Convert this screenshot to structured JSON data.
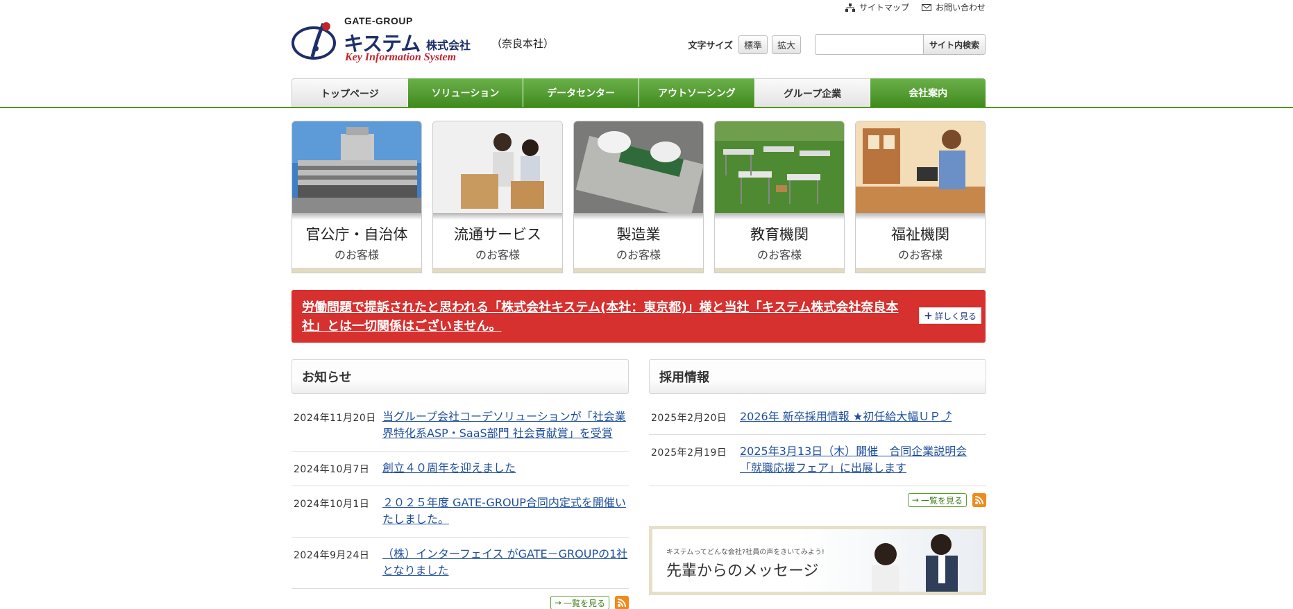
{
  "header": {
    "logo": {
      "group": "GATE-GROUP",
      "name": "キステム",
      "suffix": "株式会社",
      "branch": "（奈良本社）",
      "tagline": "Key Information System"
    },
    "util_links": [
      {
        "label": "サイトマップ",
        "icon": "sitemap-icon"
      },
      {
        "label": "お問い合わせ",
        "icon": "mail-icon"
      }
    ],
    "font_size": {
      "label": "文字サイズ",
      "normal": "標準",
      "large": "拡大"
    },
    "search": {
      "value": "",
      "placeholder": "",
      "button": "サイト内検索"
    }
  },
  "nav": [
    {
      "label": "トップページ",
      "style": "light"
    },
    {
      "label": "ソリューション",
      "style": "green"
    },
    {
      "label": "データセンター",
      "style": "green"
    },
    {
      "label": "アウトソーシング",
      "style": "green"
    },
    {
      "label": "グループ企業",
      "style": "light"
    },
    {
      "label": "会社案内",
      "style": "green"
    }
  ],
  "categories": [
    {
      "title": "官公庁・自治体",
      "sub": "のお客様",
      "image": "government-building-photo"
    },
    {
      "title": "流通サービス",
      "sub": "のお客様",
      "image": "delivery-staff-photo"
    },
    {
      "title": "製造業",
      "sub": "のお客様",
      "image": "circuit-board-photo"
    },
    {
      "title": "教育機関",
      "sub": "のお客様",
      "image": "school-desks-photo"
    },
    {
      "title": "福祉機関",
      "sub": "のお客様",
      "image": "welfare-worker-photo"
    }
  ],
  "alert": {
    "text": "労働問題で提訴されたと思われる「株式会社キステム(本社：東京都)」様と当社「キステム株式会社奈良本社」とは一切関係はございません。",
    "button": "詳しく見る"
  },
  "news": {
    "title": "お知らせ",
    "items": [
      {
        "date": "2024年11月20日",
        "text": "当グループ会社コーデソリューションが「社会業界特化系ASP・SaaS部門 社会貢献賞」を受賞"
      },
      {
        "date": "2024年10月7日",
        "text": "創立４０周年を迎えました"
      },
      {
        "date": "2024年10月1日",
        "text": "２０２５年度 GATE-GROUP合同内定式を開催いたしました。"
      },
      {
        "date": "2024年9月24日",
        "text": "（株）インターフェイス がGATE－GROUPの1社となりました"
      }
    ],
    "more": "一覧を見る"
  },
  "recruit": {
    "title": "採用情報",
    "items": [
      {
        "date": "2025年2月20日",
        "text": "2026年 新卒採用情報 ★初任給大幅ＵＰ⤴"
      },
      {
        "date": "2025年2月19日",
        "text": "2025年3月13日（木）開催　合同企業説明会「就職応援フェア」に出展します"
      }
    ],
    "more": "一覧を見る"
  },
  "promo": {
    "small": "キステムってどんな会社?社員の声をきいてみよう!",
    "big": "先輩からのメッセージ"
  },
  "colors": {
    "nav_green": "#4f951f",
    "alert_red": "#d6302f",
    "link_blue": "#1f4f9c",
    "logo_navy": "#1d2f6b",
    "logo_red": "#c0262d",
    "tile_bar": "#e1dbc2",
    "rss_orange": "#f08a1c"
  }
}
